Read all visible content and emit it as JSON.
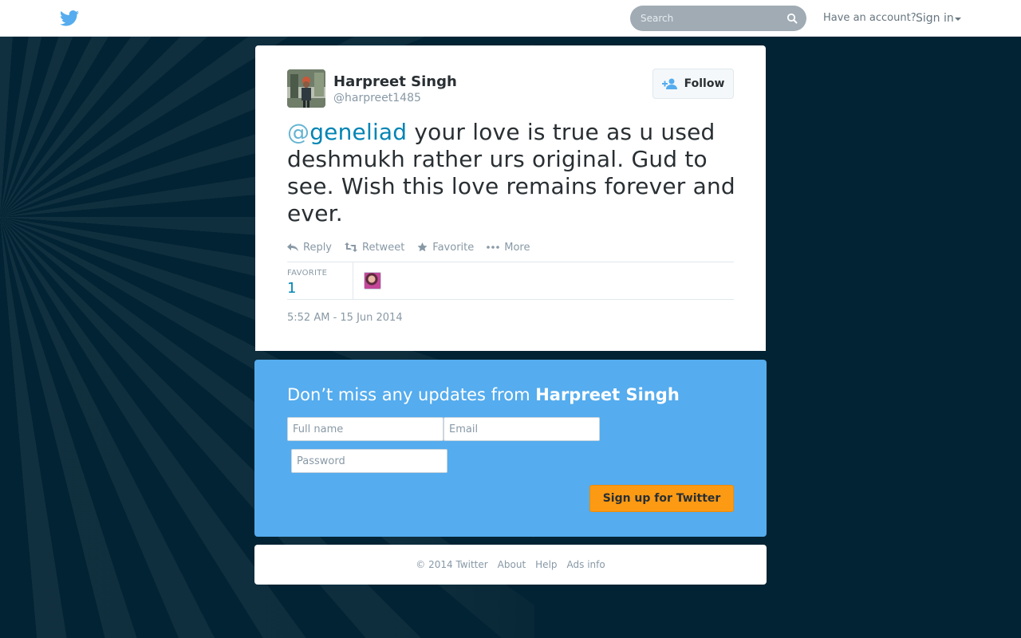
{
  "topbar": {
    "logo_icon": "twitter-bird-icon",
    "search_placeholder": "Search",
    "have_account": "Have an account?",
    "sign_in": "Sign in"
  },
  "tweet": {
    "author": {
      "fullname": "Harpreet Singh",
      "username": "@harpreet1485"
    },
    "follow_label": "Follow",
    "mention_at": "@",
    "mention_name": "geneliad",
    "text": " your love is true as u used deshmukh rather urs original.  Gud to see. Wish this love remains forever and ever.",
    "actions": {
      "reply": "Reply",
      "retweet": "Retweet",
      "favorite": "Favorite",
      "more": "More"
    },
    "stats": {
      "label": "FAVORITE",
      "count": "1"
    },
    "timestamp": "5:52 AM - 15 Jun 2014"
  },
  "signup": {
    "title_prefix": "Don’t miss any updates from ",
    "title_name": "Harpreet Singh",
    "fullname_placeholder": "Full name",
    "email_placeholder": "Email",
    "password_placeholder": "Password",
    "button_label": "Sign up for Twitter"
  },
  "footer": {
    "copyright": "© 2014 Twitter",
    "about": "About",
    "help": "Help",
    "ads_info": "Ads info"
  },
  "colors": {
    "brand_blue": "#55acee",
    "link_blue": "#0084b4",
    "signup_orange": "#fc9a14",
    "background": "#022333"
  }
}
